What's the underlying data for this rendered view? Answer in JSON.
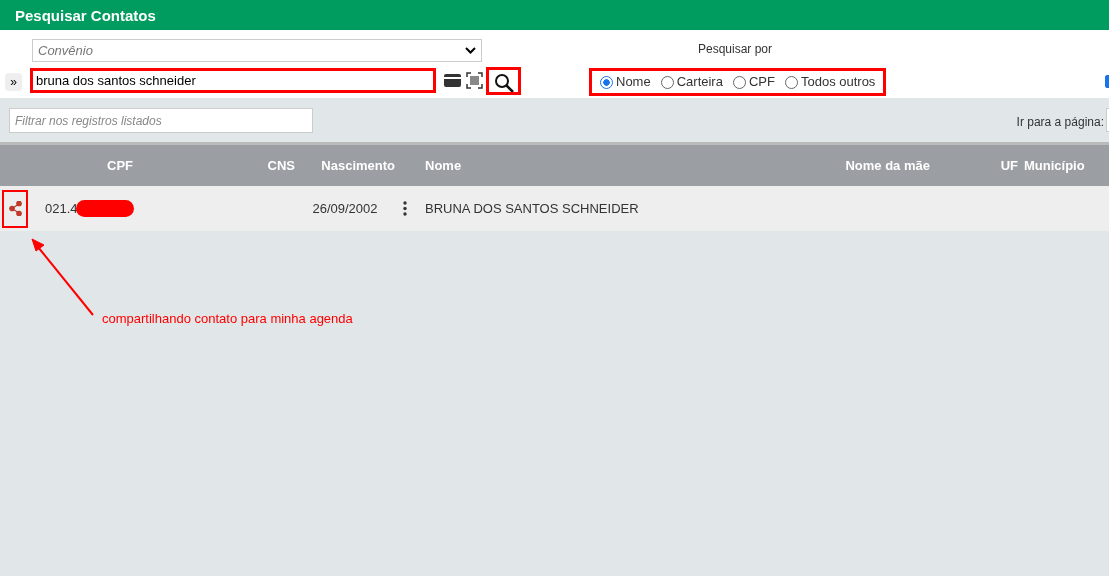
{
  "header": {
    "title": "Pesquisar Contatos"
  },
  "search": {
    "toggle": "»",
    "convenio_placeholder": "Convênio",
    "query": "bruna dos santos schneider",
    "query_highlighted": true,
    "search_button_highlighted": true,
    "search_by_label": "Pesquisar por",
    "search_by_highlighted": true,
    "search_by": [
      {
        "label": "Nome",
        "selected": true
      },
      {
        "label": "Carteira",
        "selected": false
      },
      {
        "label": "CPF",
        "selected": false
      },
      {
        "label": "Todos outros",
        "selected": false
      }
    ],
    "edge_checkbox": {
      "checked": true
    }
  },
  "filter": {
    "placeholder": "Filtrar nos registros listados"
  },
  "pagination": {
    "label": "Ir para a página:"
  },
  "table": {
    "columns": [
      "CPF",
      "CNS",
      "Nascimento",
      "Nome",
      "Nome da mãe",
      "UF",
      "Município"
    ],
    "rows": [
      {
        "share_highlighted": true,
        "cpf": "021.4",
        "cpf_redacted": true,
        "cns": "",
        "nascimento": "26/09/2002",
        "nome": "BRUNA DOS SANTOS SCHNEIDER"
      }
    ]
  },
  "annotation": {
    "text": "compartilhando contato para minha agenda"
  }
}
